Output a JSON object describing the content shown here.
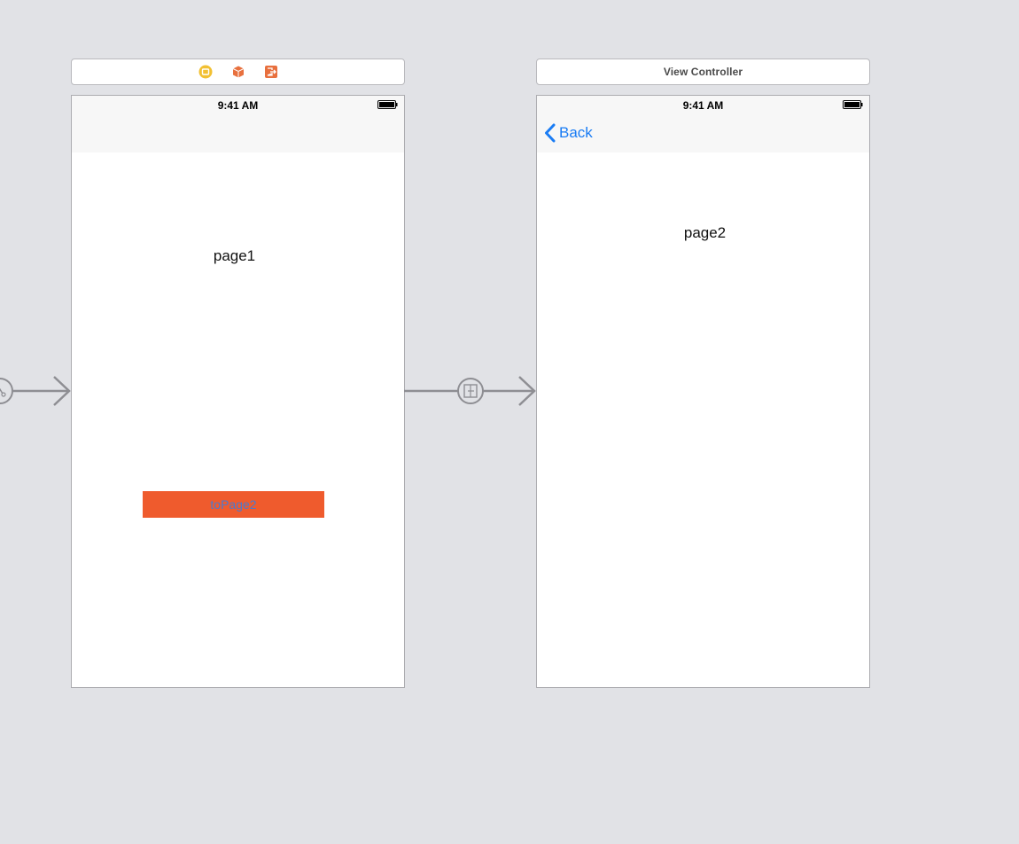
{
  "scene1": {
    "dock_icons": [
      "view-controller-icon",
      "first-responder-icon",
      "exit-icon"
    ],
    "status_time": "9:41 AM",
    "label": "page1",
    "button_label": "toPage2"
  },
  "scene2": {
    "title": "View Controller",
    "status_time": "9:41 AM",
    "back_label": "Back",
    "label": "page2"
  },
  "colors": {
    "canvas": "#e1e2e6",
    "button_bg": "#ef5b2d",
    "button_text": "#4a7ad0",
    "tint": "#1a7cf4",
    "segue": "#8e8e93"
  }
}
